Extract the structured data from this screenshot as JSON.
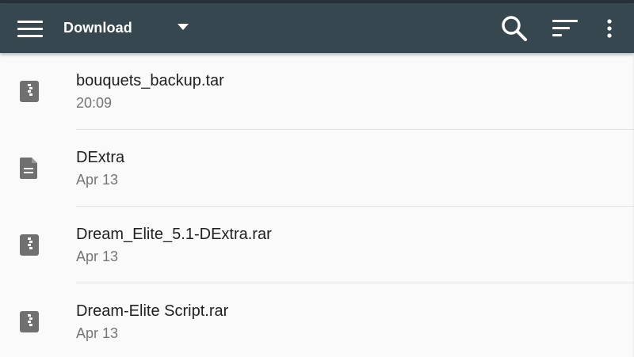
{
  "toolbar": {
    "title": "Download",
    "icons": {
      "menu": "hamburger-menu-icon",
      "dropdown": "dropdown-arrow-icon",
      "search": "search-icon",
      "sort": "sort-icon",
      "more": "more-vert-icon"
    }
  },
  "files": [
    {
      "name": "bouquets_backup.tar",
      "date": "20:09",
      "icon": "archive-icon"
    },
    {
      "name": "DExtra",
      "date": "Apr 13",
      "icon": "document-icon"
    },
    {
      "name": "Dream_Elite_5.1-DExtra.rar",
      "date": "Apr 13",
      "icon": "archive-icon"
    },
    {
      "name": "Dream-Elite Script.rar",
      "date": "Apr 13",
      "icon": "archive-icon"
    }
  ],
  "colors": {
    "toolbar": "#37474f",
    "statusbar": "#26323a",
    "background": "#fafafa",
    "icon_gray": "#707070",
    "primary_text": "#212121",
    "secondary_text": "#757575"
  }
}
